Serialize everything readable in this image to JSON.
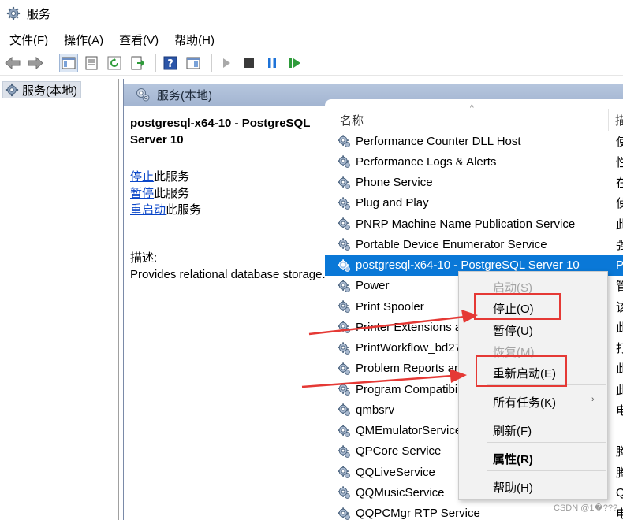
{
  "window": {
    "title": "服务",
    "app_icon": "gear-icon"
  },
  "menu": {
    "items": [
      "文件(F)",
      "操作(A)",
      "查看(V)",
      "帮助(H)"
    ]
  },
  "toolbar": {
    "icons": [
      "back-arrow-icon",
      "forward-arrow-icon",
      "console-tree-icon",
      "properties-icon",
      "refresh-icon",
      "export-list-icon",
      "help-icon",
      "show-hide-icon",
      "start-service-icon",
      "stop-service-icon",
      "pause-service-icon",
      "restart-service-icon"
    ]
  },
  "tree": {
    "root_label": "服务(本地)"
  },
  "pane": {
    "header_label": "服务(本地)",
    "selected_service_title": "postgresql-x64-10 - PostgreSQL Server 10",
    "actions": [
      {
        "link": "停止",
        "suffix": "此服务"
      },
      {
        "link": "暂停",
        "suffix": "此服务"
      },
      {
        "link": "重启动",
        "suffix": "此服务"
      }
    ],
    "description_label": "描述:",
    "description_text": "Provides relational database storage."
  },
  "list": {
    "column_name": "名称",
    "column_description": "描",
    "sort_indicator": "^",
    "rows": [
      {
        "name": "Performance Counter DLL Host",
        "desc": "使"
      },
      {
        "name": "Performance Logs & Alerts",
        "desc": "性"
      },
      {
        "name": "Phone Service",
        "desc": "在"
      },
      {
        "name": "Plug and Play",
        "desc": "使"
      },
      {
        "name": "PNRP Machine Name Publication Service",
        "desc": "此"
      },
      {
        "name": "Portable Device Enumerator Service",
        "desc": "强"
      },
      {
        "name": "postgresql-x64-10 - PostgreSQL Server 10",
        "desc": "P",
        "selected": true
      },
      {
        "name": "Power",
        "desc": "管"
      },
      {
        "name": "Print Spooler",
        "desc": "该"
      },
      {
        "name": "Printer Extensions a",
        "desc": "此"
      },
      {
        "name": "PrintWorkflow_bd27",
        "desc": "打"
      },
      {
        "name": "Problem Reports an",
        "desc": "此"
      },
      {
        "name": "Program Compatibi",
        "desc": "此"
      },
      {
        "name": "qmbsrv",
        "desc": "电"
      },
      {
        "name": "QMEmulatorService",
        "desc": ""
      },
      {
        "name": "QPCore Service",
        "desc": "腾"
      },
      {
        "name": "QQLiveService",
        "desc": "腾"
      },
      {
        "name": "QQMusicService",
        "desc": "Q"
      },
      {
        "name": "QQPCMgr RTP Service",
        "desc": "电"
      }
    ]
  },
  "context_menu": {
    "items": [
      {
        "label": "启动(S)",
        "disabled": true
      },
      {
        "label": "停止(O)",
        "highlighted": true
      },
      {
        "label": "暂停(U)"
      },
      {
        "label": "恢复(M)",
        "disabled": true
      },
      {
        "label": "重新启动(E)",
        "highlighted": true
      },
      {
        "label": "所有任务(K)",
        "submenu": true
      },
      {
        "label": "刷新(F)"
      },
      {
        "label": "属性(R)",
        "bold": true
      },
      {
        "label": "帮助(H)"
      }
    ],
    "submenu_arrow": "›"
  },
  "colors": {
    "selection": "#0a78d7",
    "annotation_red": "#e53935",
    "link_blue": "#0a46c8",
    "pane_header": "#a3b5d1"
  },
  "watermark": "CSDN @1�???"
}
